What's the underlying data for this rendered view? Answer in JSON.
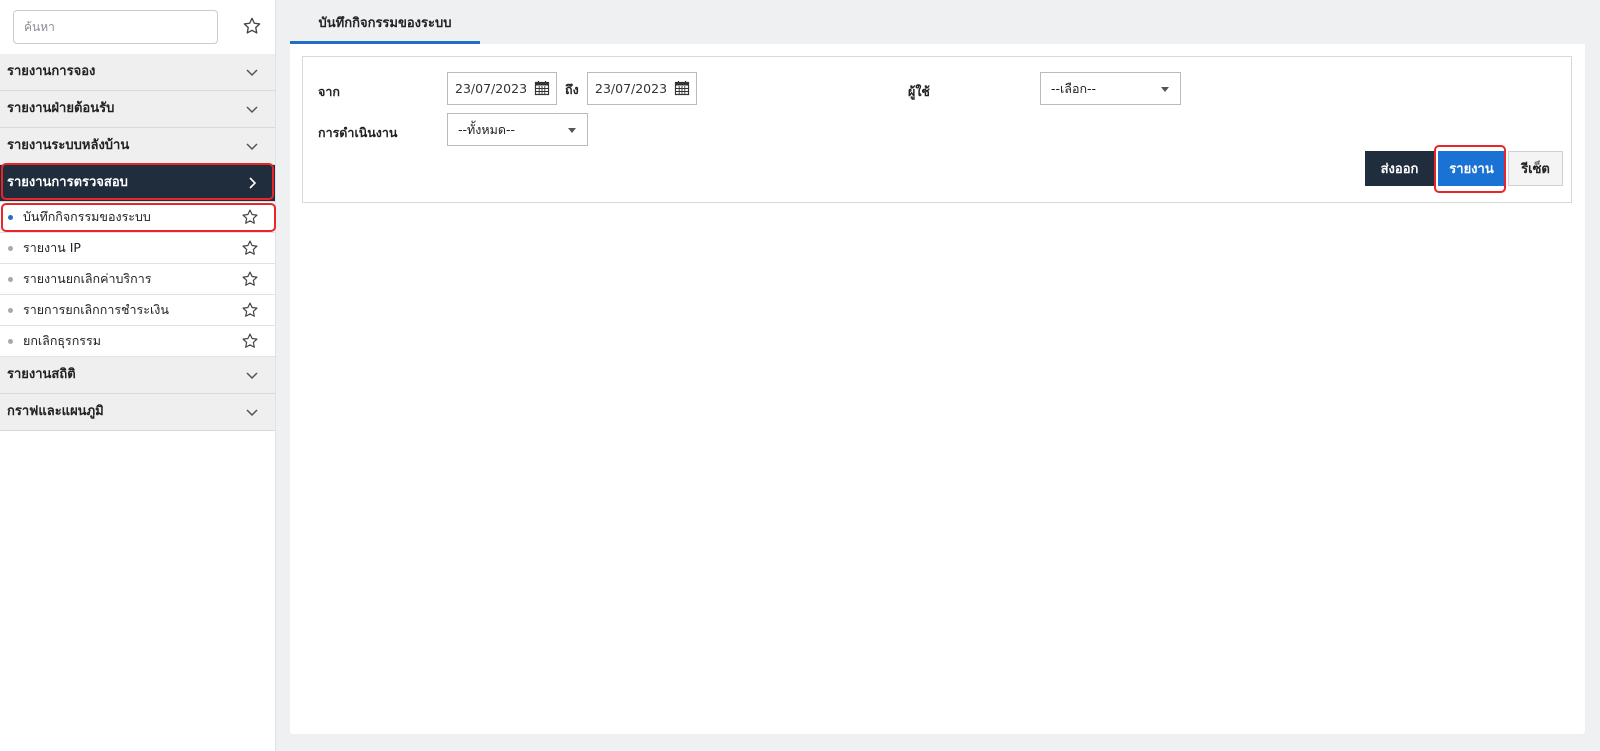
{
  "sidebar": {
    "search_placeholder": "ค้นหา",
    "groups_top": [
      {
        "label": "รายงานการจอง"
      },
      {
        "label": "รายงานฝ่ายต้อนรับ"
      },
      {
        "label": "รายงานระบบหลังบ้าน"
      }
    ],
    "active_group": {
      "label": "รายงานการตรวจสอบ"
    },
    "items": [
      {
        "label": "บันทึกกิจกรรมของระบบ"
      },
      {
        "label": "รายงาน IP"
      },
      {
        "label": "รายงานยกเลิกค่าบริการ"
      },
      {
        "label": "รายการยกเลิกการชำระเงิน"
      },
      {
        "label": "ยกเลิกธุรกรรม"
      }
    ],
    "groups_bottom": [
      {
        "label": "รายงานสถิติ"
      },
      {
        "label": "กราฟและแผนภูมิ"
      }
    ]
  },
  "main": {
    "tab_label": "บันทึกกิจกรรมของระบบ",
    "form": {
      "from_label": "จาก",
      "from_date": "23/07/2023",
      "to_label": "ถึง",
      "to_date": "23/07/2023",
      "user_label": "ผู้ใช้",
      "user_select": "--เลือก--",
      "operation_label": "การดำเนินงาน",
      "operation_select": "--ทั้งหมด--"
    },
    "buttons": {
      "export": "ส่งออก",
      "report": "รายงาน",
      "reset": "รีเซ็ต"
    }
  },
  "colors": {
    "accent": "#1a73d4",
    "dark": "#1f2d3d",
    "highlight": "#e8262a"
  }
}
